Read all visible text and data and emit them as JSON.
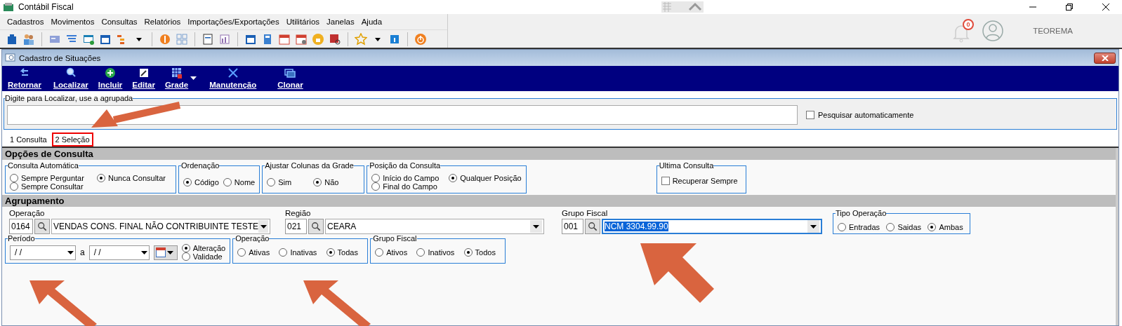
{
  "app": {
    "title": "Contábil Fiscal"
  },
  "menu": [
    {
      "label": "Cadastros"
    },
    {
      "label": "Movimentos"
    },
    {
      "label": "Consultas"
    },
    {
      "label": "Relatórios"
    },
    {
      "label": "Importações/Exportações"
    },
    {
      "label": "Utilitários"
    },
    {
      "label": "Janelas"
    },
    {
      "label": "Ajuda"
    }
  ],
  "notifications": {
    "count": "0"
  },
  "user": {
    "name": "TEOREMA"
  },
  "child_window": {
    "title": "Cadastro de Situações"
  },
  "actions": [
    {
      "label": "Retornar",
      "dropdown": false
    },
    {
      "label": "Localizar",
      "dropdown": false
    },
    {
      "label": "Incluir",
      "dropdown": false
    },
    {
      "label": "Editar",
      "dropdown": false
    },
    {
      "label": "Grade",
      "dropdown": true
    },
    {
      "label": "Manutenção",
      "dropdown": false
    },
    {
      "label": "Clonar",
      "dropdown": false
    }
  ],
  "search": {
    "label": "Digite para Localizar, use a agrupada",
    "auto_search": {
      "label": "Pesquisar automaticamente",
      "checked": false
    }
  },
  "tabs": [
    {
      "label": "1 Consulta",
      "selected": false
    },
    {
      "label": "2 Seleção",
      "selected": true
    }
  ],
  "options_section": {
    "title": "Opções de Consulta",
    "groups": [
      {
        "title": "Consulta Automática",
        "kind": "radio",
        "options": [
          {
            "label": "Sempre Perguntar",
            "selected": false
          },
          {
            "label": "Nunca Consultar",
            "selected": true
          },
          {
            "label": "Sempre Consultar",
            "selected": false
          }
        ]
      },
      {
        "title": "Ordenação",
        "kind": "radio",
        "options": [
          {
            "label": "Código",
            "selected": true
          },
          {
            "label": "Nome",
            "selected": false
          }
        ]
      },
      {
        "title": "Ajustar Colunas da Grade",
        "kind": "radio",
        "options": [
          {
            "label": "Sim",
            "selected": false
          },
          {
            "label": "Não",
            "selected": true
          }
        ]
      },
      {
        "title": "Posição da Consulta",
        "kind": "radio",
        "options": [
          {
            "label": "Início do Campo",
            "selected": false
          },
          {
            "label": "Qualquer Posição",
            "selected": true
          },
          {
            "label": "Final do Campo",
            "selected": false
          }
        ]
      },
      {
        "title": "Ultima Consulta",
        "kind": "checkbox",
        "options": [
          {
            "label": "Recuperar Sempre",
            "selected": false
          }
        ]
      }
    ]
  },
  "grouping_section": {
    "title": "Agrupamento",
    "lookups": [
      {
        "label": "Operação",
        "code": "0164",
        "description": "VENDAS  CONS. FINAL NÃO CONTRIBUINTE TESTE",
        "focused": false
      },
      {
        "label": "Região",
        "code": "021",
        "description": "CEARA",
        "focused": false
      },
      {
        "label": "Grupo Fiscal",
        "code": "001",
        "description": "NCM 3304.99.90",
        "focused": true
      }
    ],
    "operation_type": {
      "title": "Tipo Operação",
      "options": [
        {
          "label": "Entradas",
          "selected": false
        },
        {
          "label": "Saidas",
          "selected": false
        },
        {
          "label": "Ambas",
          "selected": true
        }
      ]
    },
    "period": {
      "title": "Período",
      "from": "/ /",
      "separator": "a",
      "to": "/ /",
      "options": [
        {
          "label": "Alteração",
          "selected": true
        },
        {
          "label": "Validade",
          "selected": false
        }
      ]
    },
    "filters": [
      {
        "title": "Operação",
        "options": [
          {
            "label": "Ativas",
            "selected": false
          },
          {
            "label": "Inativas",
            "selected": false
          },
          {
            "label": "Todas",
            "selected": true
          }
        ]
      },
      {
        "title": "Grupo Fiscal",
        "options": [
          {
            "label": "Ativos",
            "selected": false
          },
          {
            "label": "Inativos",
            "selected": false
          },
          {
            "label": "Todos",
            "selected": true
          }
        ]
      }
    ]
  }
}
